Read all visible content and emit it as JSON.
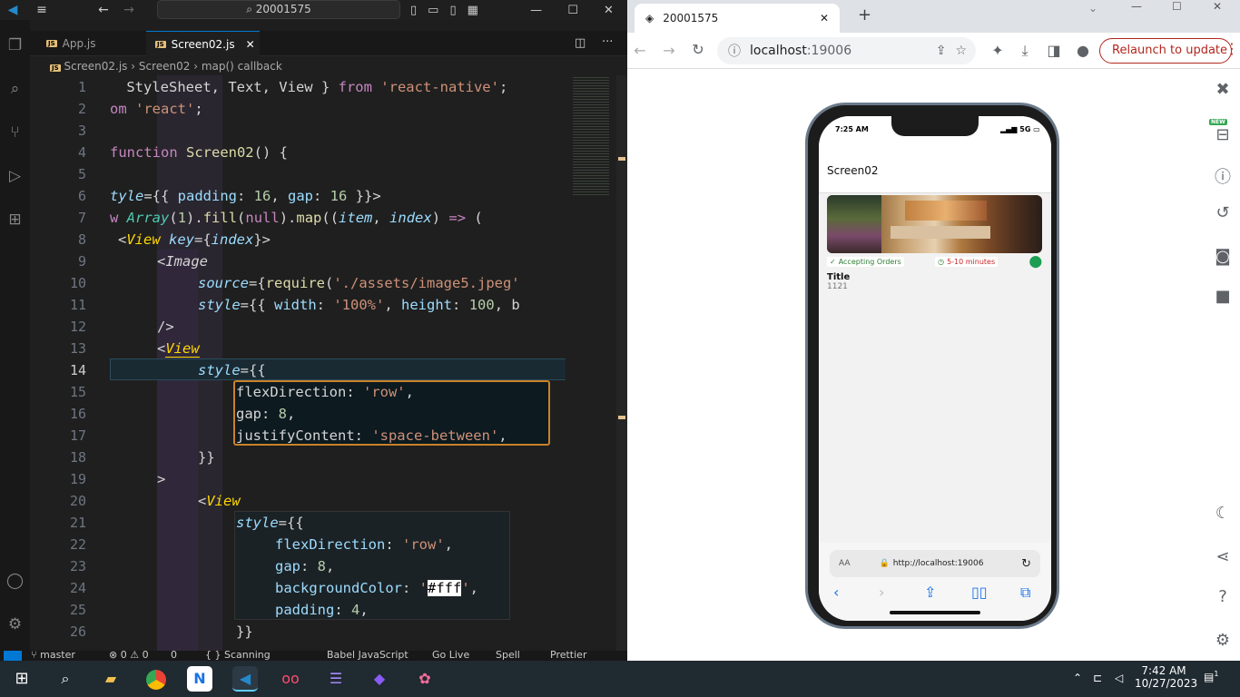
{
  "vscode": {
    "search": "20001575",
    "tabs": [
      {
        "label": "App.js",
        "active": false
      },
      {
        "label": "Screen02.js",
        "active": true
      }
    ],
    "breadcrumb": [
      "Screen02.js",
      "Screen02",
      "map() callback"
    ],
    "line_numbers": [
      "1",
      "2",
      "3",
      "4",
      "5",
      "6",
      "7",
      "8",
      "9",
      "10",
      "11",
      "12",
      "13",
      "14",
      "15",
      "16",
      "17",
      "18",
      "19",
      "20",
      "21",
      "22",
      "23",
      "24",
      "25",
      "26"
    ],
    "current_line": "14",
    "status": {
      "branch": "master",
      "problems": "⊗ 0 ⚠ 0",
      "ports": "0",
      "scanning": "{ } Scanning",
      "language": "Babel JavaScript",
      "golive": "Go Live",
      "spell": "Spell",
      "prettier": "Prettier"
    }
  },
  "chrome": {
    "tab_title": "20001575",
    "url_host": "localhost",
    "url_port": ":19006",
    "relaunch": "Relaunch to update",
    "new_badge": "NEW"
  },
  "phone": {
    "time": "7:25 AM",
    "signal": "5G",
    "screen_title": "Screen02",
    "badge_accepting": "Accepting Orders",
    "badge_time": "5-10 minutes",
    "card_title": "Title",
    "card_sub": "1121",
    "aa": "AA",
    "url": "http://localhost:19006"
  },
  "taskbar": {
    "time": "7:42 AM",
    "date": "10/27/2023",
    "notifications": "1"
  }
}
